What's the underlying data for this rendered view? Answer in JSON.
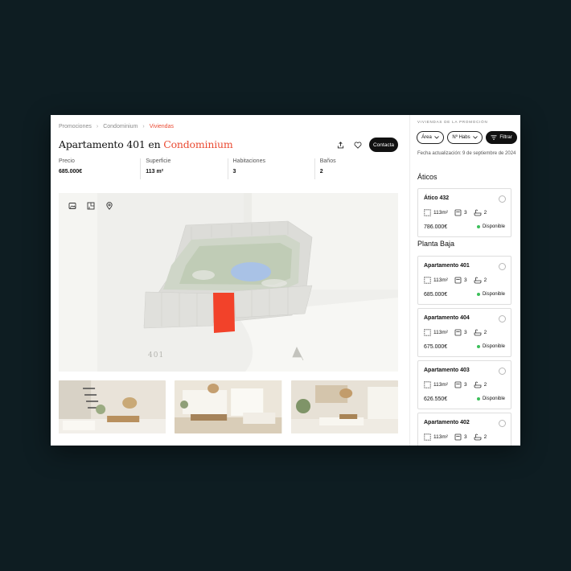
{
  "breadcrumb": {
    "items": [
      "Promociones",
      "Condominium",
      "Viviendas"
    ]
  },
  "property": {
    "title_prefix": "Apartamento 401 en",
    "title_accent": "Condominium",
    "contact_label": "Contacta",
    "unit_number": "401"
  },
  "stats": [
    {
      "label": "Precio",
      "value": "685.000€"
    },
    {
      "label": "Superficie",
      "value": "113 m²"
    },
    {
      "label": "Habitaciones",
      "value": "3"
    },
    {
      "label": "Baños",
      "value": "2"
    }
  ],
  "sidebar": {
    "heading": "VIVIENDAS DE LA PROMOCIÓN",
    "filters": {
      "area": "Área",
      "rooms": "Nº Habs",
      "filter": "Filtrar"
    },
    "update_label": "Fecha actualización:",
    "update_value": "9 de septiembre de 2024",
    "sections": [
      {
        "title": "Áticos",
        "units": [
          {
            "name": "Ático 432",
            "area": "113m²",
            "rooms": "3",
            "baths": "2",
            "price": "786.000€",
            "status": "Disponible"
          }
        ]
      },
      {
        "title": "Planta Baja",
        "units": [
          {
            "name": "Apartamento 401",
            "area": "113m²",
            "rooms": "3",
            "baths": "2",
            "price": "685.000€",
            "status": "Disponible"
          },
          {
            "name": "Apartamento 404",
            "area": "113m²",
            "rooms": "3",
            "baths": "2",
            "price": "675.000€",
            "status": "Disponible"
          },
          {
            "name": "Apartamento 403",
            "area": "113m²",
            "rooms": "3",
            "baths": "2",
            "price": "626.550€",
            "status": "Disponible"
          },
          {
            "name": "Apartamento 402",
            "area": "113m²",
            "rooms": "3",
            "baths": "2",
            "price": "",
            "status": ""
          }
        ]
      }
    ]
  },
  "colors": {
    "accent": "#ea4b33",
    "available": "#3cbf5a",
    "background": "#0e1d22"
  }
}
